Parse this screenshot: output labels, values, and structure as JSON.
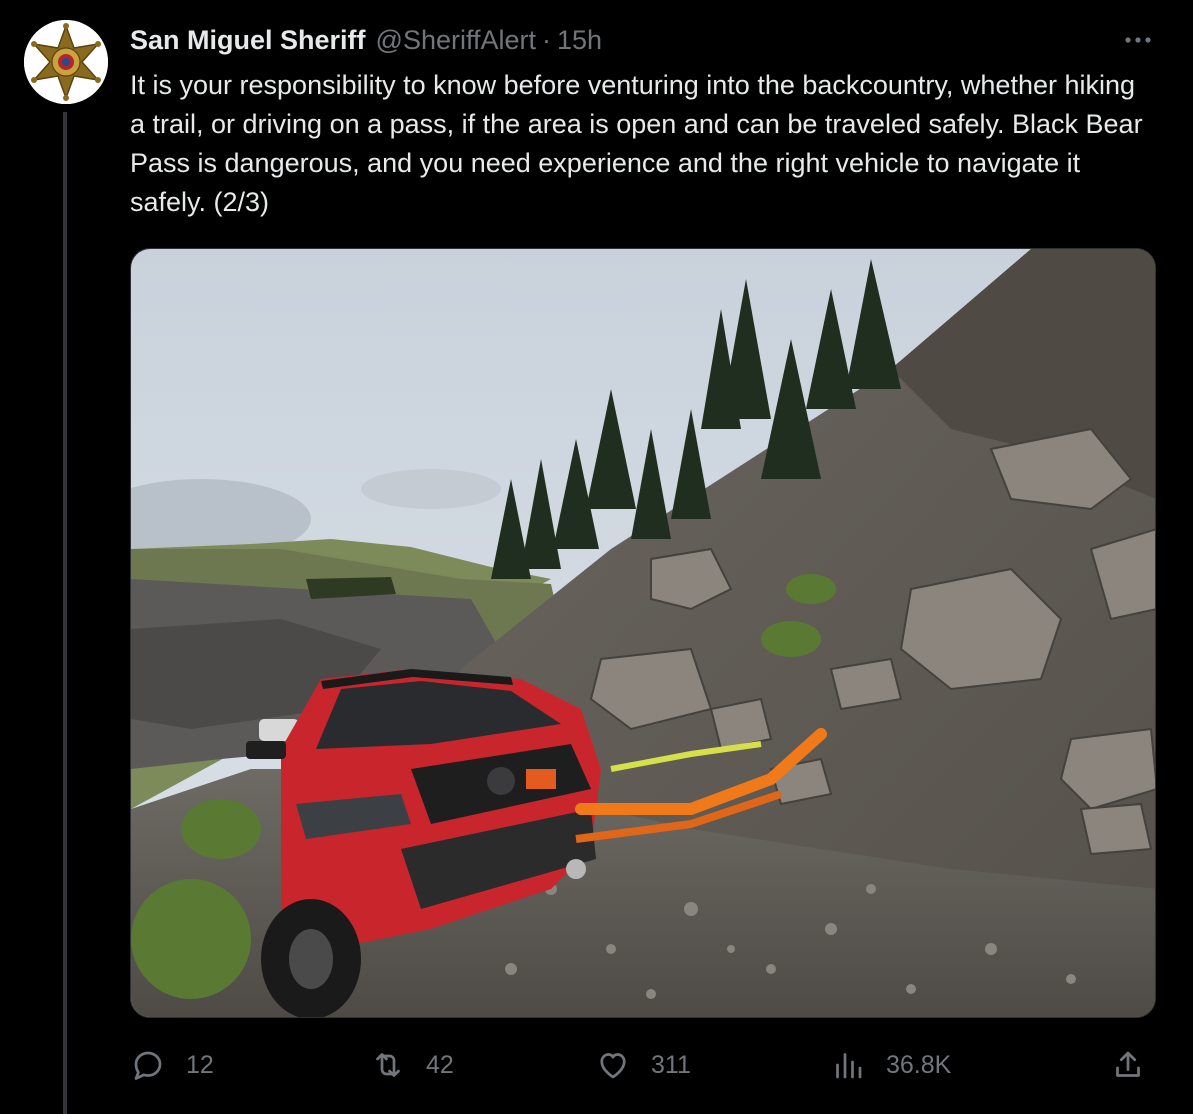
{
  "tweet": {
    "author_name": "San Miguel Sheriff",
    "handle": "@SheriffAlert",
    "separator": "·",
    "time": "15h",
    "text": "It is your responsibility to know before venturing into the backcountry, whether hiking a trail, or driving on a pass, if the area is open and can be traveled safely. Black Bear Pass is dangerous, and you need experience and the right vehicle to navigate it safely. (2/3)"
  },
  "media": {
    "alt": "Red SUV stuck on a rocky mountain pass with orange tow straps attached"
  },
  "actions": {
    "replies": "12",
    "reposts": "42",
    "likes": "311",
    "views": "36.8K"
  },
  "icons": {
    "avatar": "sheriff-star-badge-icon",
    "more": "more-dots-icon",
    "reply": "reply-bubble-icon",
    "repost": "repost-arrows-icon",
    "like": "heart-icon",
    "views": "bar-chart-icon",
    "share": "share-upload-icon"
  },
  "colors": {
    "background": "#000000",
    "text_primary": "#e7e9ea",
    "text_secondary": "#71767b",
    "vehicle_red": "#c8262c",
    "strap_orange": "#f07a1a"
  }
}
